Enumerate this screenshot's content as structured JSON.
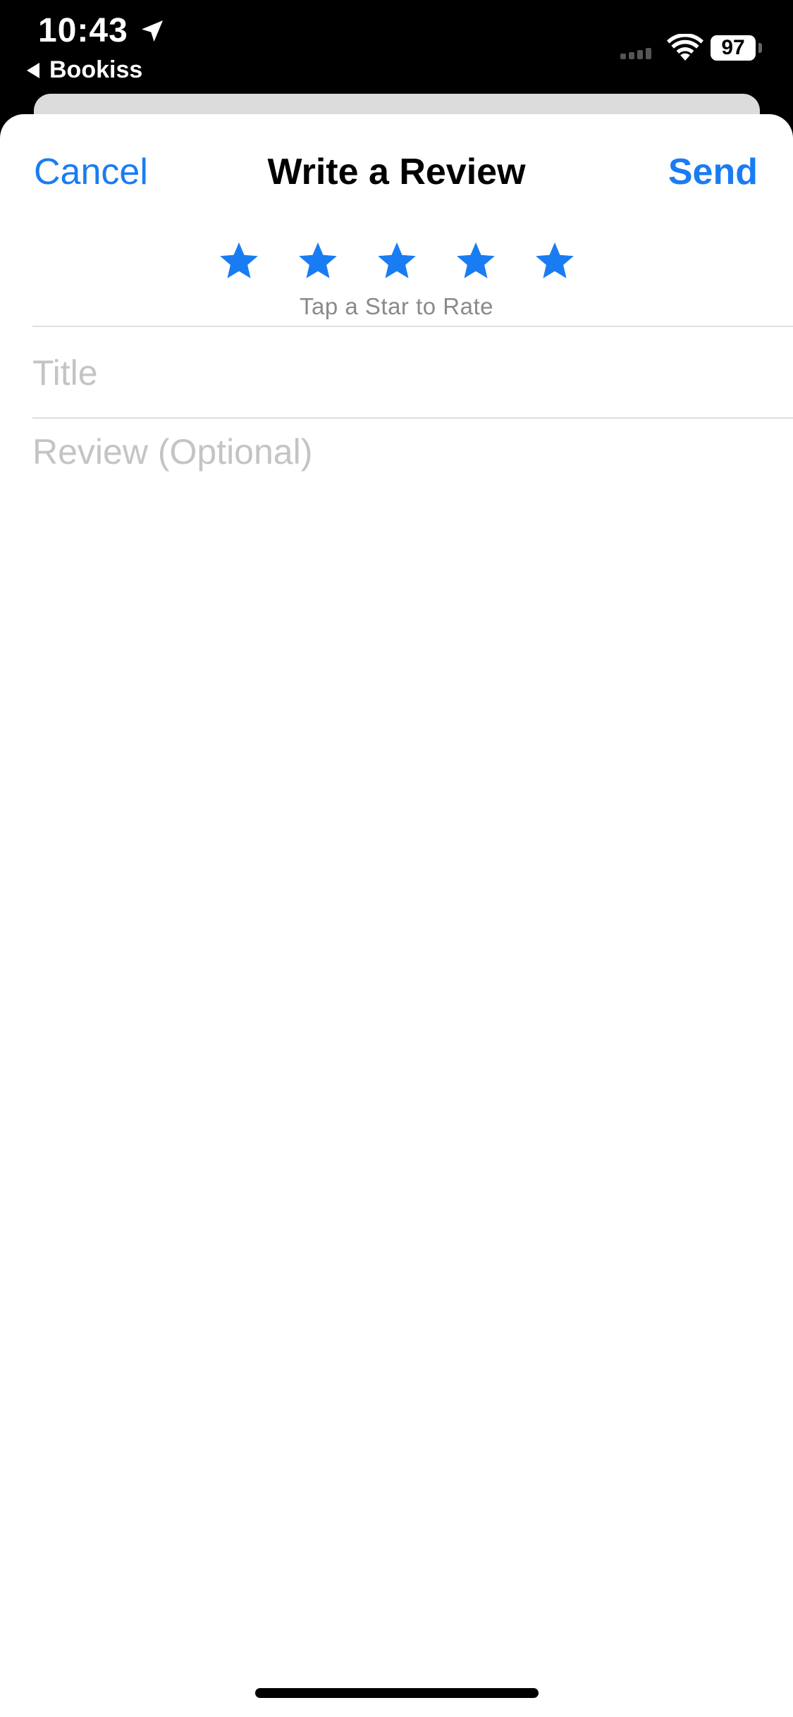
{
  "status_bar": {
    "time": "10:43",
    "back_app": "Bookiss",
    "battery": "97",
    "icons": [
      "location-arrow-icon",
      "signal-icon",
      "wifi-icon",
      "battery-icon"
    ]
  },
  "sheet": {
    "title": "Write a Review",
    "cancel_label": "Cancel",
    "send_label": "Send",
    "rating": {
      "max_stars": 5,
      "selected": 0,
      "hint": "Tap a Star to Rate",
      "star_color": "#1a7cf3"
    },
    "title_field": {
      "placeholder": "Title",
      "value": ""
    },
    "review_field": {
      "placeholder": "Review (Optional)",
      "value": ""
    }
  },
  "colors": {
    "accent": "#1a7cf3",
    "placeholder": "#c4c4c6",
    "hint": "#8a8a8e"
  }
}
